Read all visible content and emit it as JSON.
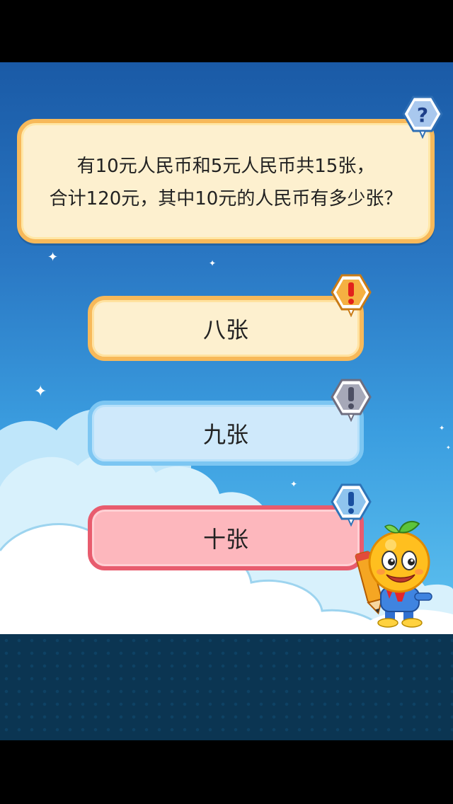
{
  "question": {
    "line1": "有10元人民币和5元人民币共15张，",
    "line2": "合计120元，其中10元的人民币有多少张？"
  },
  "answers": [
    {
      "label": "八张",
      "color": "#f7b95a"
    },
    {
      "label": "九张",
      "color": "#7cc6f2"
    },
    {
      "label": "十张",
      "color": "#e85c6e"
    }
  ],
  "icons": {
    "question_badge": "question-mark-icon",
    "answer_badges": [
      "exclamation-red-icon",
      "exclamation-gray-icon",
      "exclamation-blue-icon"
    ],
    "mascot": "orange-mascot-with-pencil"
  },
  "colors": {
    "sky_top": "#1a5aa6",
    "sky_bottom": "#5fc3f0",
    "footer": "#0b3552"
  }
}
